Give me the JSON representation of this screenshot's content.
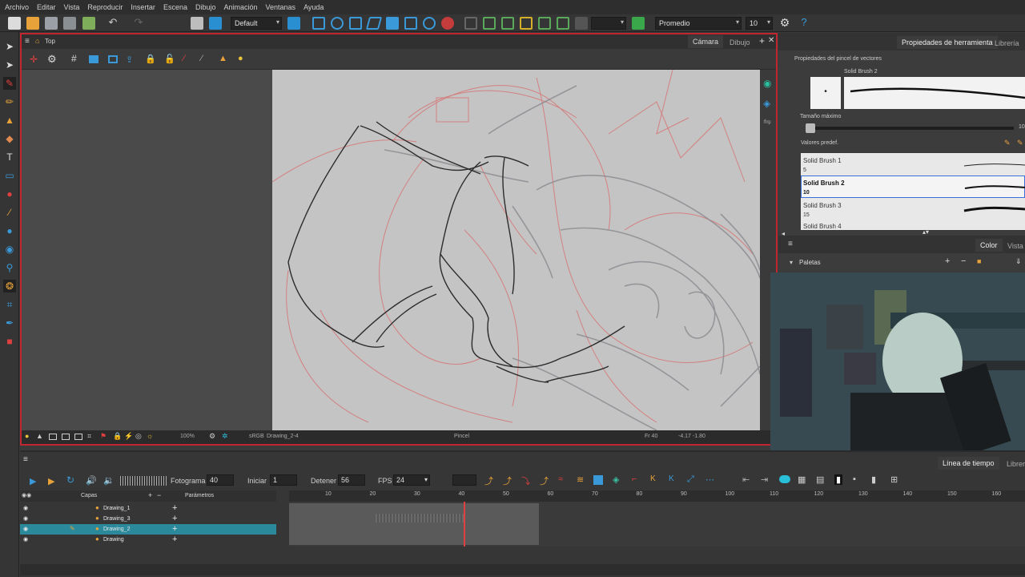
{
  "menu": [
    "Archivo",
    "Editar",
    "Vista",
    "Reproducir",
    "Insertar",
    "Escena",
    "Dibujo",
    "Animación",
    "Ventanas",
    "Ayuda"
  ],
  "toolbar": {
    "workspace": "Default",
    "brush_mode": "Promedio",
    "brush_size": "10"
  },
  "camera_view": {
    "breadcrumb": "Top",
    "tab_camera": "Cámara",
    "tab_drawing": "Dibujo",
    "zoom": "100%",
    "colorspace": "sRGB",
    "drawing_name": "Drawing_2-4",
    "tool_name": "Pincel",
    "frame_status": "Fr 40",
    "coords": "-4.17 -1.80"
  },
  "tool_properties": {
    "tab_properties": "Propiedades de herramienta",
    "tab_library": "Librería",
    "section_title": "Propiedades del pincel de vectores",
    "current_brush": "Solid Brush 2",
    "dot": "•",
    "max_size_label": "Tamaño máximo",
    "max_size_value": "10",
    "presets_label": "Valores predef.",
    "presets": [
      {
        "name": "Solid Brush 1",
        "size": "5",
        "selected": false
      },
      {
        "name": "Solid Brush 2",
        "size": "10",
        "selected": true
      },
      {
        "name": "Solid Brush 3",
        "size": "15",
        "selected": false
      },
      {
        "name": "Solid Brush 4",
        "size": "",
        "selected": false
      }
    ]
  },
  "color_panel": {
    "tab_color": "Color",
    "tab_view": "Vista",
    "palettes_label": "Paletas"
  },
  "timeline": {
    "frame_label": "Fotograma",
    "frame_value": "40",
    "start_label": "Iniciar",
    "start_value": "1",
    "stop_label": "Detener",
    "stop_value": "56",
    "fps_label": "FPS",
    "fps_value": "24",
    "layers_header": "Capas",
    "params_header": "Parámetros",
    "tab_timeline": "Línea de tiempo",
    "tab_library": "Librería",
    "ruler": [
      "10",
      "20",
      "30",
      "40",
      "50",
      "60",
      "70",
      "80",
      "90",
      "100",
      "110",
      "120",
      "130",
      "140",
      "150",
      "160"
    ],
    "layers": [
      {
        "name": "Drawing_1",
        "selected": false
      },
      {
        "name": "Drawing_3",
        "selected": false
      },
      {
        "name": "Drawing_2",
        "selected": true
      },
      {
        "name": "Drawing",
        "selected": false
      }
    ]
  },
  "colors": {
    "accent_red": "#c0262f",
    "selection_teal": "#2a8a9c",
    "panel_bg": "#3c3c3c"
  }
}
